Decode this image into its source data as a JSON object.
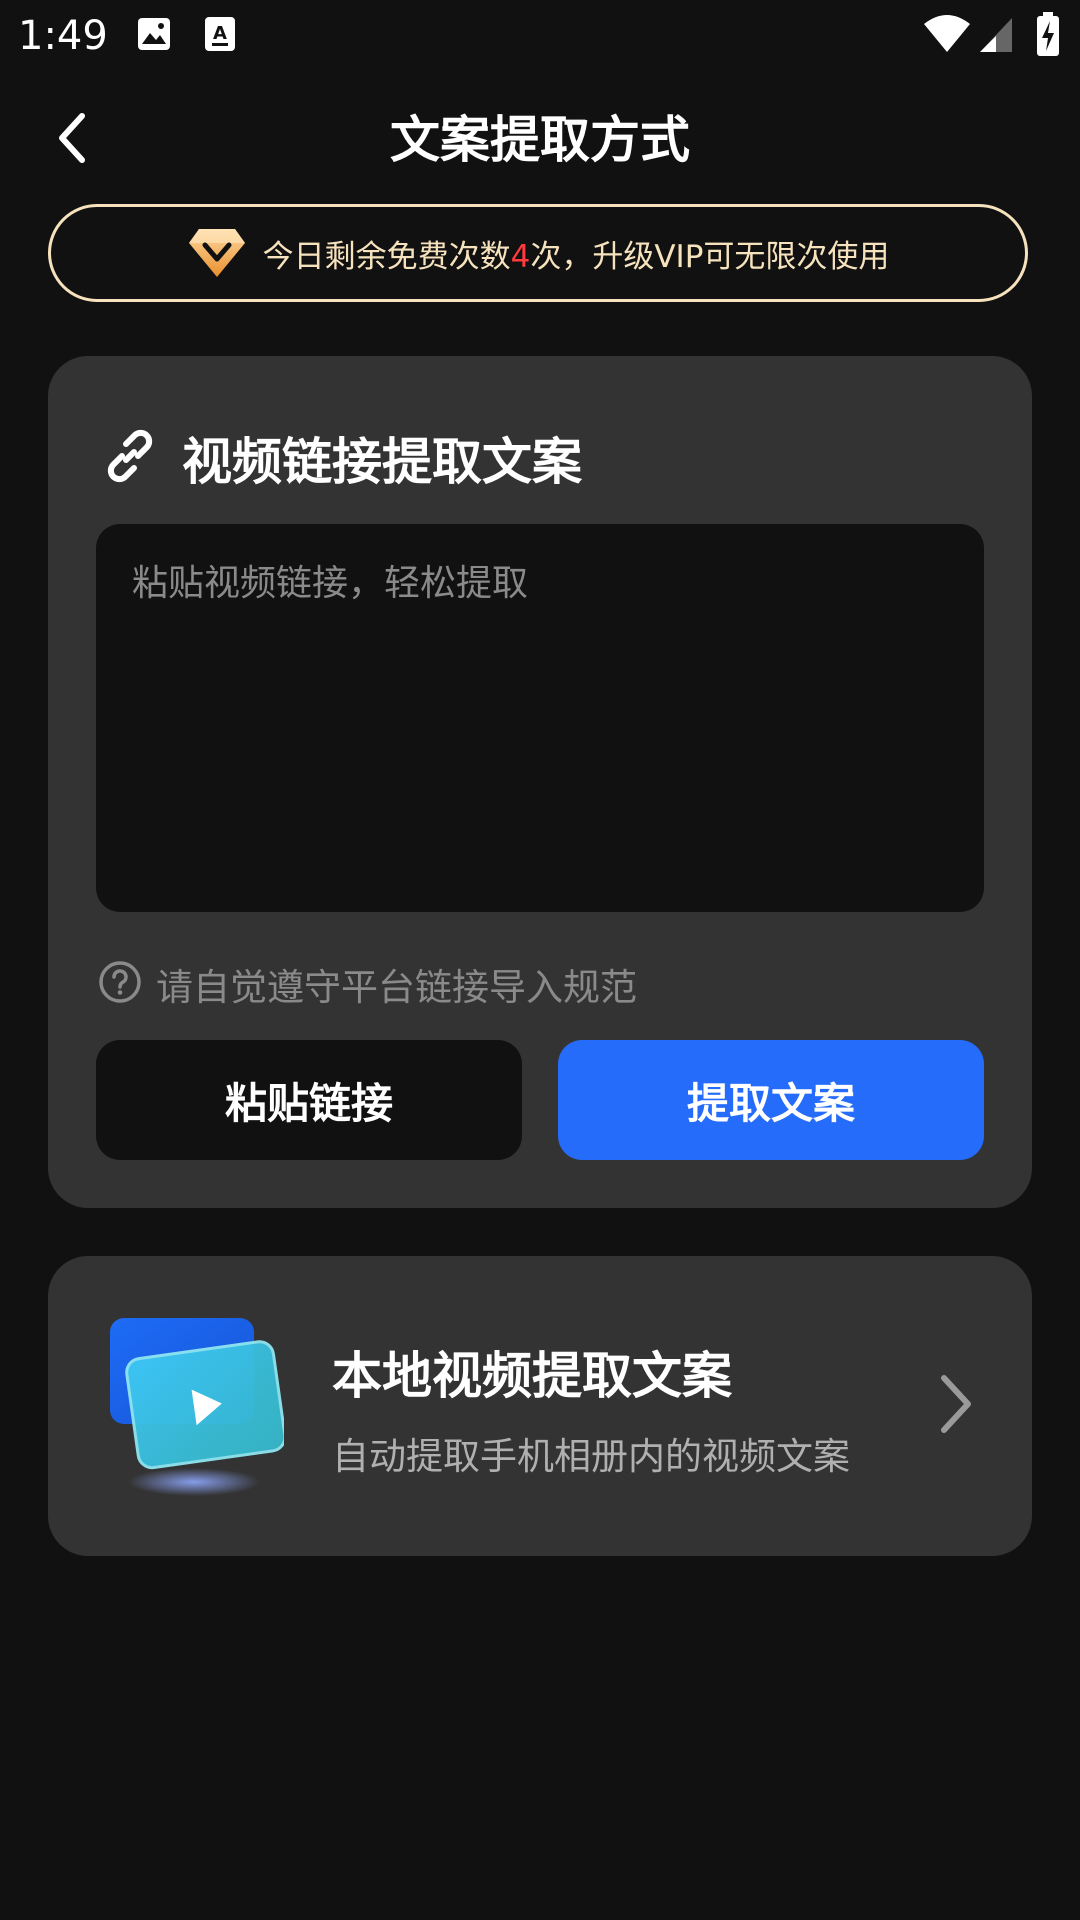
{
  "status_bar": {
    "time": "1:49",
    "icons": [
      "image-icon",
      "accessibility-text-icon",
      "wifi-icon",
      "cellular-signal-icon",
      "battery-charging-icon"
    ]
  },
  "header": {
    "title": "文案提取方式",
    "back_icon": "chevron-left-icon"
  },
  "vip_banner": {
    "icon": "vip-diamond-icon",
    "text_before": "今日剩余免费次数",
    "remaining_count": "4",
    "text_after": "次，升级VIP可无限次使用",
    "border_color": "#f6e3bd",
    "count_color": "#ff3b3b"
  },
  "link_card": {
    "icon": "link-icon",
    "title": "视频链接提取文案",
    "input": {
      "value": "",
      "placeholder": "粘贴视频链接，轻松提取"
    },
    "rule_icon": "question-circle-icon",
    "rule_text": "请自觉遵守平台链接导入规范",
    "paste_button_label": "粘贴链接",
    "extract_button_label": "提取文案",
    "accent_color": "#266cfb"
  },
  "local_card": {
    "icon": "local-video-icon",
    "title": "本地视频提取文案",
    "subtitle": "自动提取手机相册内的视频文案",
    "chevron_icon": "chevron-right-icon"
  }
}
